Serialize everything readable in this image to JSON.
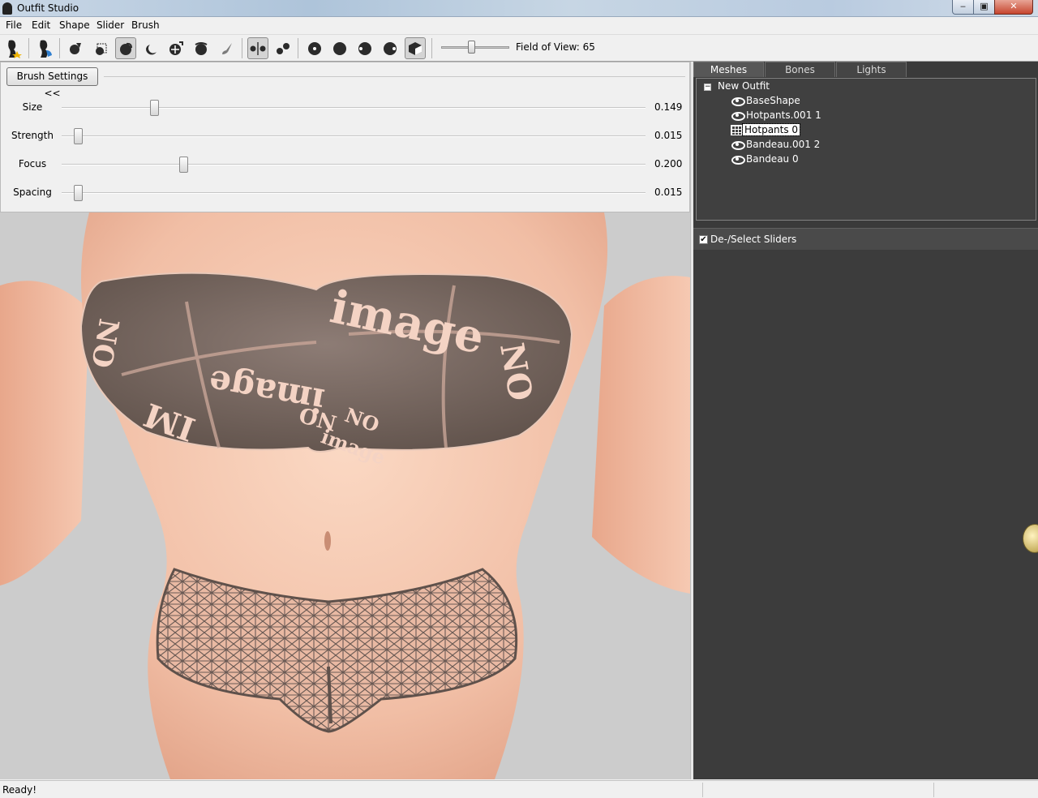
{
  "window": {
    "title": "Outfit Studio"
  },
  "menu": [
    "File",
    "Edit",
    "Shape",
    "Slider",
    "Brush"
  ],
  "toolbar": {
    "fov_label": "Field of View: 65",
    "fov_value": 65
  },
  "brush_settings": {
    "toggle_label": "Brush Settings <<",
    "sliders": [
      {
        "label": "Size",
        "value": "0.149",
        "fraction": 0.149
      },
      {
        "label": "Strength",
        "value": "0.015",
        "fraction": 0.015
      },
      {
        "label": "Focus",
        "value": "0.200",
        "fraction": 0.2
      },
      {
        "label": "Spacing",
        "value": "0.015",
        "fraction": 0.015
      }
    ]
  },
  "viewport": {
    "texture_text": [
      "image",
      "NO",
      "image",
      "NO",
      "NO",
      "image",
      "IM",
      "NO"
    ]
  },
  "right_panel": {
    "tabs": [
      "Meshes",
      "Bones",
      "Lights"
    ],
    "active_tab": "Meshes",
    "tree": {
      "root": "New Outfit",
      "expander": "−",
      "items": [
        {
          "label": "BaseShape",
          "icon": "eye-icon"
        },
        {
          "label": "Hotpants.001 1",
          "icon": "eye-icon"
        },
        {
          "label": "Hotpants 0",
          "icon": "grid-icon",
          "selected": true
        },
        {
          "label": "Bandeau.001 2",
          "icon": "eye-icon"
        },
        {
          "label": "Bandeau 0",
          "icon": "eye-icon"
        }
      ]
    },
    "sliders_header": {
      "label": "De-/Select Sliders",
      "checked": true
    }
  },
  "status": {
    "text": "Ready!"
  },
  "colors": {
    "panel_dark": "#3a3a3a",
    "viewport_bg": "#cccccc",
    "skin": "#f2c4ad",
    "fabric": "#7a6a64"
  }
}
